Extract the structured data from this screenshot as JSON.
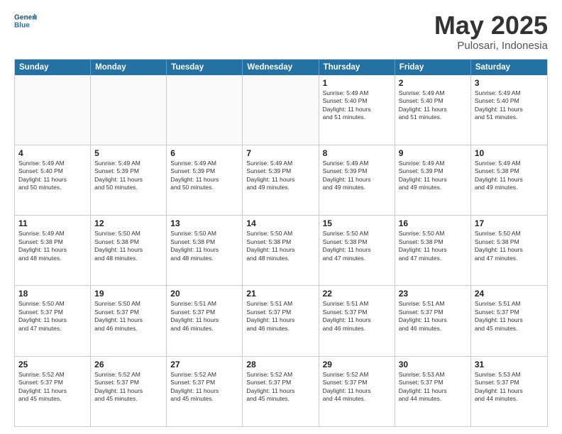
{
  "logo": {
    "line1": "General",
    "line2": "Blue"
  },
  "title": "May 2025",
  "subtitle": "Pulosari, Indonesia",
  "header": {
    "days": [
      "Sunday",
      "Monday",
      "Tuesday",
      "Wednesday",
      "Thursday",
      "Friday",
      "Saturday"
    ]
  },
  "rows": [
    {
      "cells": [
        {
          "day": "",
          "text": "",
          "empty": true
        },
        {
          "day": "",
          "text": "",
          "empty": true
        },
        {
          "day": "",
          "text": "",
          "empty": true
        },
        {
          "day": "",
          "text": "",
          "empty": true
        },
        {
          "day": "1",
          "text": "Sunrise: 5:49 AM\nSunset: 5:40 PM\nDaylight: 11 hours\nand 51 minutes.",
          "empty": false
        },
        {
          "day": "2",
          "text": "Sunrise: 5:49 AM\nSunset: 5:40 PM\nDaylight: 11 hours\nand 51 minutes.",
          "empty": false
        },
        {
          "day": "3",
          "text": "Sunrise: 5:49 AM\nSunset: 5:40 PM\nDaylight: 11 hours\nand 51 minutes.",
          "empty": false
        }
      ]
    },
    {
      "cells": [
        {
          "day": "4",
          "text": "Sunrise: 5:49 AM\nSunset: 5:40 PM\nDaylight: 11 hours\nand 50 minutes.",
          "empty": false
        },
        {
          "day": "5",
          "text": "Sunrise: 5:49 AM\nSunset: 5:39 PM\nDaylight: 11 hours\nand 50 minutes.",
          "empty": false
        },
        {
          "day": "6",
          "text": "Sunrise: 5:49 AM\nSunset: 5:39 PM\nDaylight: 11 hours\nand 50 minutes.",
          "empty": false
        },
        {
          "day": "7",
          "text": "Sunrise: 5:49 AM\nSunset: 5:39 PM\nDaylight: 11 hours\nand 49 minutes.",
          "empty": false
        },
        {
          "day": "8",
          "text": "Sunrise: 5:49 AM\nSunset: 5:39 PM\nDaylight: 11 hours\nand 49 minutes.",
          "empty": false
        },
        {
          "day": "9",
          "text": "Sunrise: 5:49 AM\nSunset: 5:39 PM\nDaylight: 11 hours\nand 49 minutes.",
          "empty": false
        },
        {
          "day": "10",
          "text": "Sunrise: 5:49 AM\nSunset: 5:38 PM\nDaylight: 11 hours\nand 49 minutes.",
          "empty": false
        }
      ]
    },
    {
      "cells": [
        {
          "day": "11",
          "text": "Sunrise: 5:49 AM\nSunset: 5:38 PM\nDaylight: 11 hours\nand 48 minutes.",
          "empty": false
        },
        {
          "day": "12",
          "text": "Sunrise: 5:50 AM\nSunset: 5:38 PM\nDaylight: 11 hours\nand 48 minutes.",
          "empty": false
        },
        {
          "day": "13",
          "text": "Sunrise: 5:50 AM\nSunset: 5:38 PM\nDaylight: 11 hours\nand 48 minutes.",
          "empty": false
        },
        {
          "day": "14",
          "text": "Sunrise: 5:50 AM\nSunset: 5:38 PM\nDaylight: 11 hours\nand 48 minutes.",
          "empty": false
        },
        {
          "day": "15",
          "text": "Sunrise: 5:50 AM\nSunset: 5:38 PM\nDaylight: 11 hours\nand 47 minutes.",
          "empty": false
        },
        {
          "day": "16",
          "text": "Sunrise: 5:50 AM\nSunset: 5:38 PM\nDaylight: 11 hours\nand 47 minutes.",
          "empty": false
        },
        {
          "day": "17",
          "text": "Sunrise: 5:50 AM\nSunset: 5:38 PM\nDaylight: 11 hours\nand 47 minutes.",
          "empty": false
        }
      ]
    },
    {
      "cells": [
        {
          "day": "18",
          "text": "Sunrise: 5:50 AM\nSunset: 5:37 PM\nDaylight: 11 hours\nand 47 minutes.",
          "empty": false
        },
        {
          "day": "19",
          "text": "Sunrise: 5:50 AM\nSunset: 5:37 PM\nDaylight: 11 hours\nand 46 minutes.",
          "empty": false
        },
        {
          "day": "20",
          "text": "Sunrise: 5:51 AM\nSunset: 5:37 PM\nDaylight: 11 hours\nand 46 minutes.",
          "empty": false
        },
        {
          "day": "21",
          "text": "Sunrise: 5:51 AM\nSunset: 5:37 PM\nDaylight: 11 hours\nand 46 minutes.",
          "empty": false
        },
        {
          "day": "22",
          "text": "Sunrise: 5:51 AM\nSunset: 5:37 PM\nDaylight: 11 hours\nand 46 minutes.",
          "empty": false
        },
        {
          "day": "23",
          "text": "Sunrise: 5:51 AM\nSunset: 5:37 PM\nDaylight: 11 hours\nand 46 minutes.",
          "empty": false
        },
        {
          "day": "24",
          "text": "Sunrise: 5:51 AM\nSunset: 5:37 PM\nDaylight: 11 hours\nand 45 minutes.",
          "empty": false
        }
      ]
    },
    {
      "cells": [
        {
          "day": "25",
          "text": "Sunrise: 5:52 AM\nSunset: 5:37 PM\nDaylight: 11 hours\nand 45 minutes.",
          "empty": false
        },
        {
          "day": "26",
          "text": "Sunrise: 5:52 AM\nSunset: 5:37 PM\nDaylight: 11 hours\nand 45 minutes.",
          "empty": false
        },
        {
          "day": "27",
          "text": "Sunrise: 5:52 AM\nSunset: 5:37 PM\nDaylight: 11 hours\nand 45 minutes.",
          "empty": false
        },
        {
          "day": "28",
          "text": "Sunrise: 5:52 AM\nSunset: 5:37 PM\nDaylight: 11 hours\nand 45 minutes.",
          "empty": false
        },
        {
          "day": "29",
          "text": "Sunrise: 5:52 AM\nSunset: 5:37 PM\nDaylight: 11 hours\nand 44 minutes.",
          "empty": false
        },
        {
          "day": "30",
          "text": "Sunrise: 5:53 AM\nSunset: 5:37 PM\nDaylight: 11 hours\nand 44 minutes.",
          "empty": false
        },
        {
          "day": "31",
          "text": "Sunrise: 5:53 AM\nSunset: 5:37 PM\nDaylight: 11 hours\nand 44 minutes.",
          "empty": false
        }
      ]
    }
  ]
}
